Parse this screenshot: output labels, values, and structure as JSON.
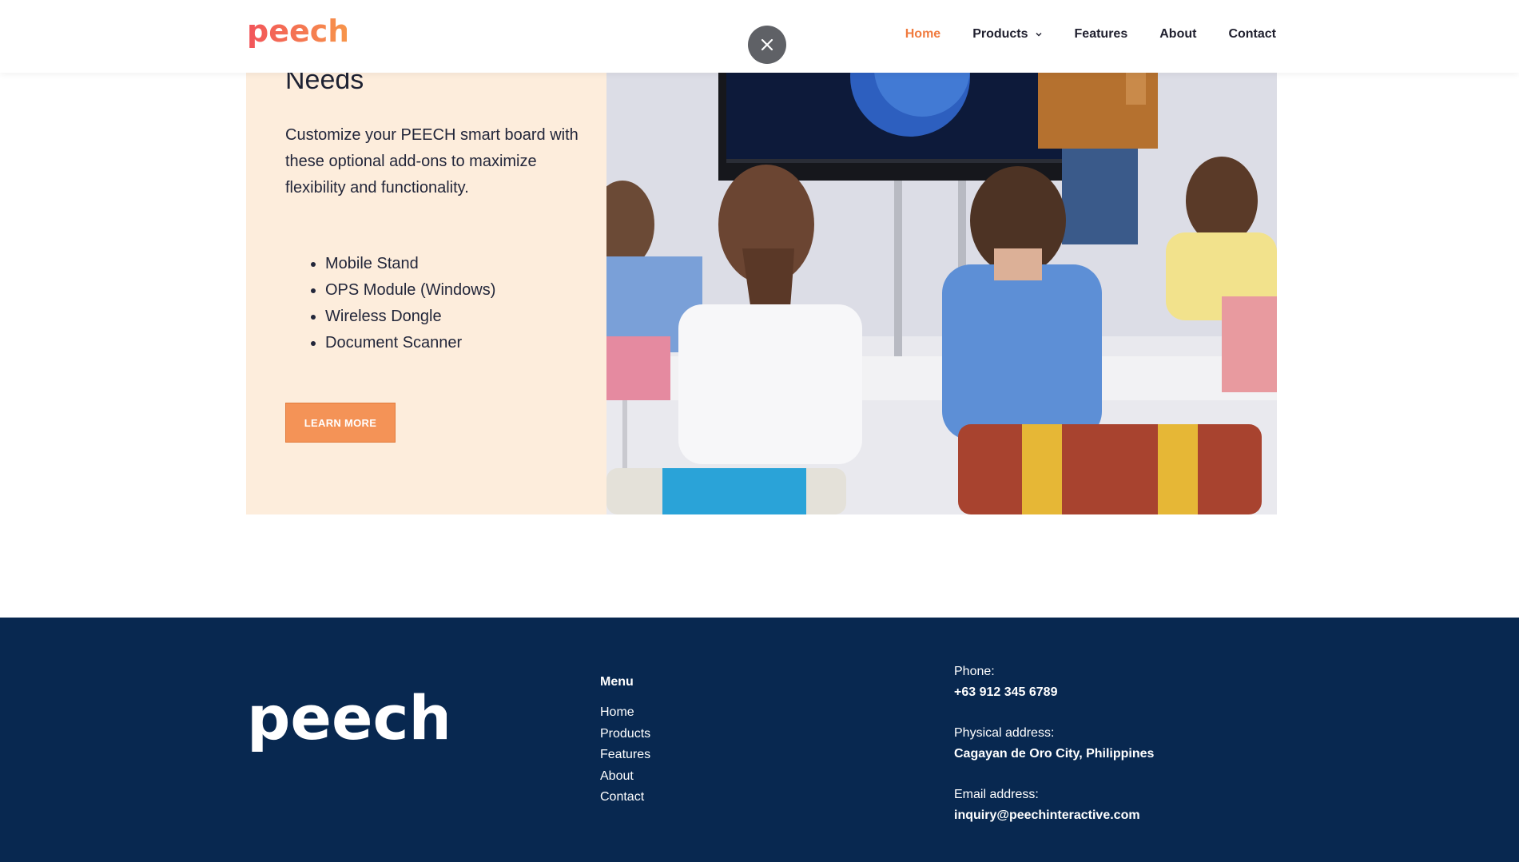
{
  "header": {
    "logo_text": "peech",
    "nav": [
      {
        "label": "Home",
        "active": true
      },
      {
        "label": "Products",
        "has_dropdown": true
      },
      {
        "label": "Features"
      },
      {
        "label": "About"
      },
      {
        "label": "Contact"
      }
    ],
    "close_icon": "close-icon"
  },
  "feature": {
    "heading": "Needs",
    "description": "Customize your PEECH smart board with these optional add-ons to maximize flexibility and functionality.",
    "items": [
      "Mobile Stand",
      "OPS Module (Windows)",
      "Wireless Dongle",
      "Document Scanner"
    ],
    "button_label": "LEARN MORE",
    "image_subject": "classroom-smartboard-photo"
  },
  "footer": {
    "logo_text": "peech",
    "menu_title": "Menu",
    "menu": [
      "Home",
      "Products",
      "Features",
      "About",
      "Contact"
    ],
    "phone_label": "Phone:",
    "phone": "+63 912 345 6789",
    "address_label": "Physical address:",
    "address": "Cagayan de Oro City, Philippines",
    "email_label": "Email address:",
    "email": "inquiry@peechinteractive.com"
  },
  "colors": {
    "accent": "#f07b3f",
    "button": "#f49357",
    "panel": "#fdeddc",
    "footer_bg": "#082850"
  }
}
